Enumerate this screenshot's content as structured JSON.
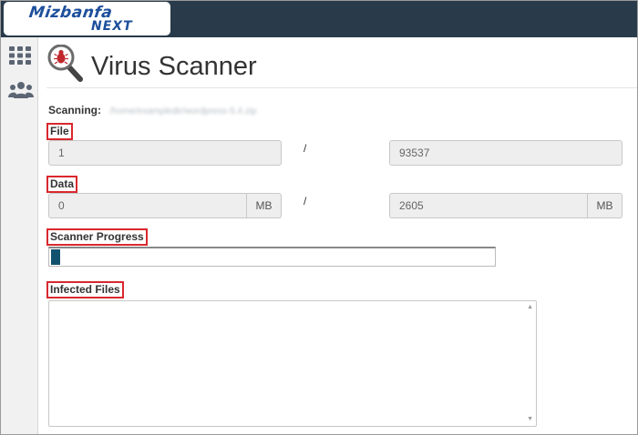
{
  "brand": {
    "name": "Mizbanfa",
    "sub": "NEXT"
  },
  "page": {
    "title": "Virus Scanner"
  },
  "scanning": {
    "label": "Scanning:",
    "path": "/home/exampledir/wordpress-5.4.zip"
  },
  "file": {
    "label": "File",
    "current": "1",
    "separator": "/",
    "total": "93537"
  },
  "data": {
    "label": "Data",
    "current": "0",
    "current_unit": "MB",
    "separator": "/",
    "total": "2605",
    "total_unit": "MB"
  },
  "progress": {
    "label": "Scanner Progress",
    "value_fraction": 0.02
  },
  "infected": {
    "label": "Infected Files",
    "value": ""
  },
  "icons": {
    "grid": "grid-icon",
    "users": "users-icon",
    "scanner": "magnifier-bug-icon",
    "scroll_up": "scroll-up-icon",
    "scroll_down": "scroll-down-icon"
  },
  "colors": {
    "topbar": "#293a4a",
    "brand": "#1d4f9c",
    "progress": "#11536e",
    "highlight": "#d9282e"
  }
}
